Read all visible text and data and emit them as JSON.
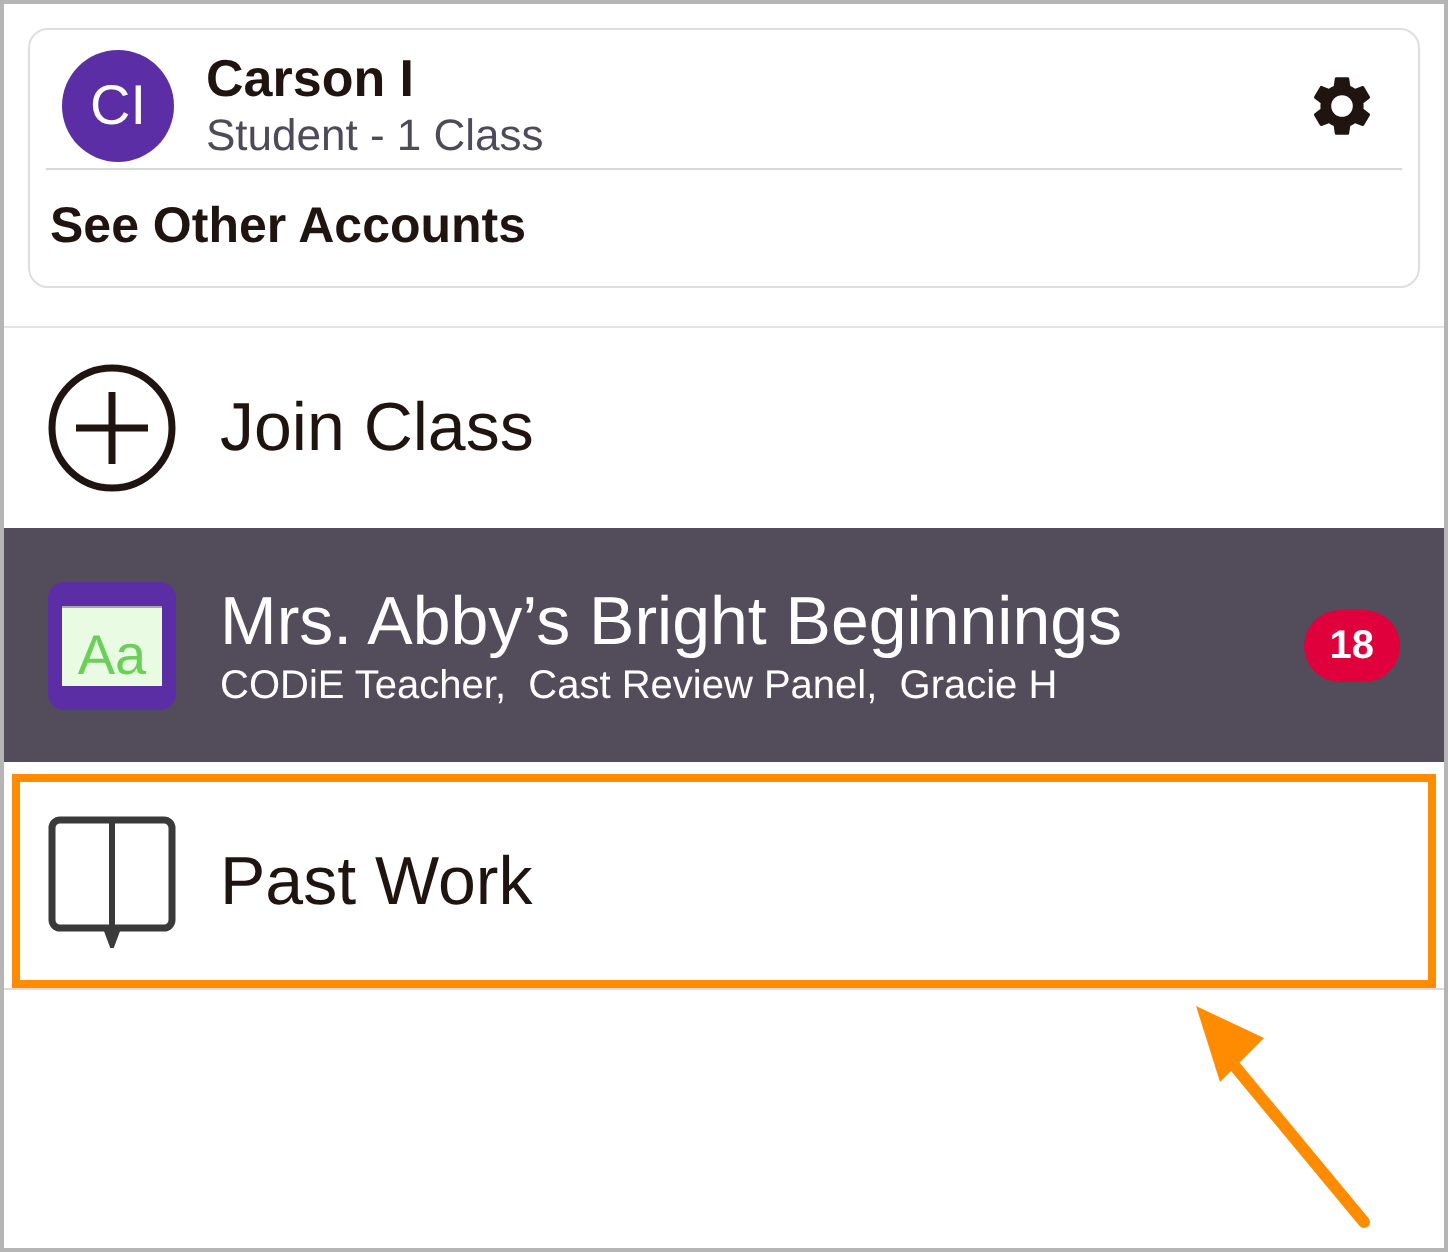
{
  "account": {
    "initials": "CI",
    "name": "Carson I",
    "role": "Student - 1 Class",
    "other_accounts": "See Other Accounts"
  },
  "menu": [
    {
      "kind": "join",
      "label": "Join Class",
      "selected": false,
      "highlighted": false
    },
    {
      "kind": "class",
      "label": "Mrs. Abby’s Bright Beginnings",
      "subtitle": "CODiE Teacher,  Cast Review Panel,  Gracie H",
      "icon_text": "Aa",
      "badge": "18",
      "selected": true,
      "highlighted": false
    },
    {
      "kind": "past_work",
      "label": "Past Work",
      "selected": false,
      "highlighted": true
    }
  ]
}
